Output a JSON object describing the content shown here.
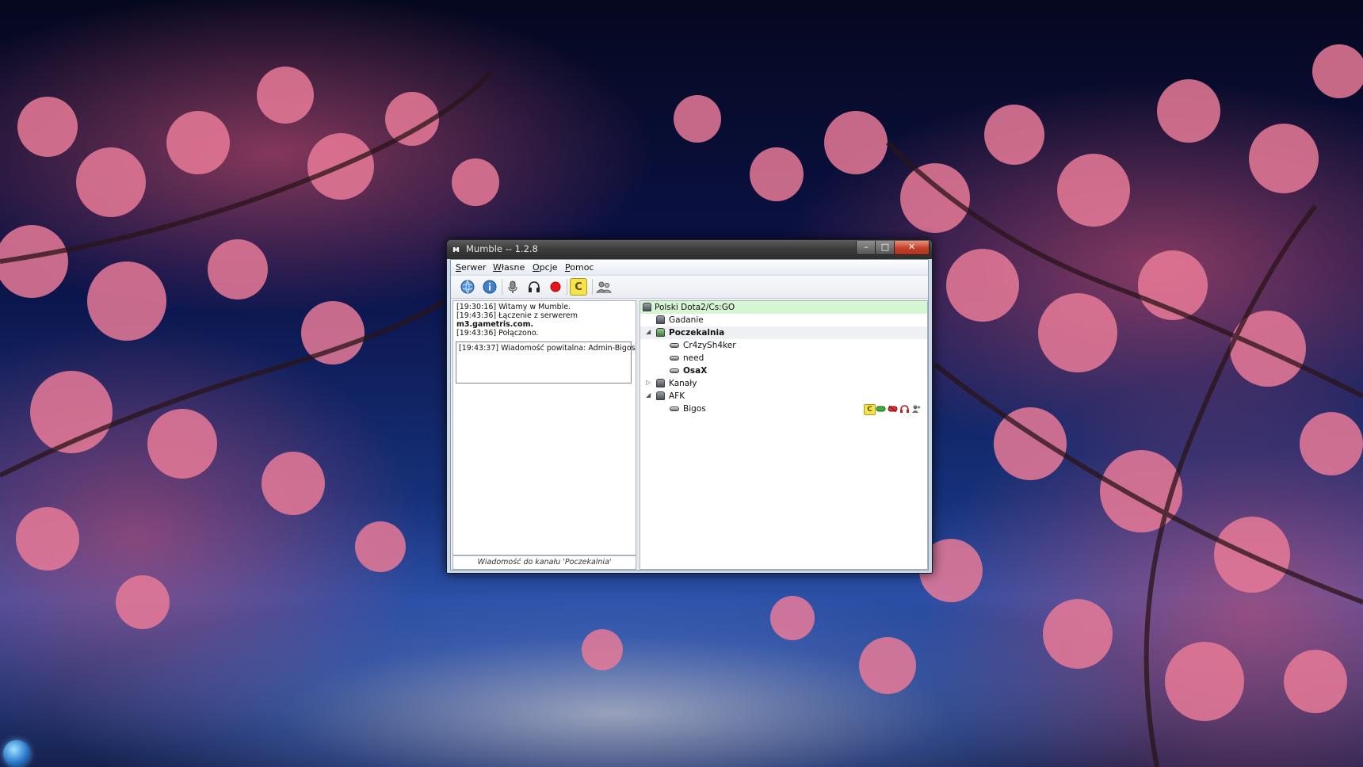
{
  "window": {
    "title": "Mumble -- 1.2.8",
    "app_icon": "mumble-icon",
    "caption_buttons": {
      "minimize": "–",
      "maximize": "□",
      "close": "✕"
    }
  },
  "menu": {
    "items": [
      {
        "label": "Serwer",
        "underline": "S",
        "rest": "erwer"
      },
      {
        "label": "Własne",
        "underline": "W",
        "rest": "łasne"
      },
      {
        "label": "Opcje",
        "underline": "O",
        "rest": "pcje"
      },
      {
        "label": "Pomoc",
        "underline": "P",
        "rest": "omoc"
      }
    ]
  },
  "toolbar": {
    "icons": [
      "connect-globe-icon",
      "info-icon",
      "mute-self-icon",
      "deafen-headphones-icon",
      "record-icon",
      "comment-icon",
      "configure-users-icon"
    ],
    "comment_glyph": "C"
  },
  "log": {
    "lines": [
      "[19:30:16] Witamy w Mumble.",
      "[19:43:36] Łączenie z serwerem",
      "m3.gametris.com.",
      "[19:43:36] Połączono."
    ],
    "welcome": "[19:43:37] Wiadomość powitalna: Admin-Bigos"
  },
  "chat": {
    "placeholder": "Wiadomość do kanału 'Poczekalnia'"
  },
  "tree": {
    "root": "Polski Dota2/Cs:GO",
    "channels": [
      {
        "name": "Gadanie"
      },
      {
        "name": "Poczekalnia",
        "users": [
          "Cr4zySh4ker",
          "need",
          "OsaX"
        ]
      },
      {
        "name": "Kanały"
      },
      {
        "name": "AFK",
        "users": [
          "Bigos"
        ]
      }
    ],
    "arrows": {
      "expanded": "◢",
      "collapsed": "▷"
    },
    "bigos_status_icons": [
      "comment-icon",
      "muted-icon",
      "deafened-icon",
      "self-deafened-icon",
      "authenticated-icon"
    ],
    "bigos_status_glyph": "C"
  },
  "colors": {
    "root_highlight": "#d6f5d3",
    "record": "#e8141a",
    "comment_bg": "#f6e34a"
  }
}
